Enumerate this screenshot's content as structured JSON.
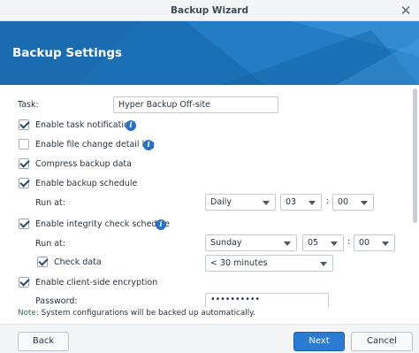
{
  "window": {
    "title": "Backup Wizard"
  },
  "header": {
    "title": "Backup Settings"
  },
  "form": {
    "task_label": "Task:",
    "task_value": "Hyper Backup Off-site",
    "enable_task_notification": {
      "label": "Enable task notification",
      "checked": true
    },
    "enable_file_change_log": {
      "label": "Enable file change detail log",
      "checked": false
    },
    "compress_backup_data": {
      "label": "Compress backup data",
      "checked": true
    },
    "enable_backup_schedule": {
      "label": "Enable backup schedule",
      "checked": true
    },
    "backup_run_at": {
      "label": "Run at:",
      "frequency": "Daily",
      "hour": "03",
      "minute": "00"
    },
    "enable_integrity_check_schedule": {
      "label": "Enable integrity check schedule",
      "checked": true
    },
    "integrity_run_at": {
      "label": "Run at:",
      "day": "Sunday",
      "hour": "05",
      "minute": "00"
    },
    "check_data": {
      "label": "Check data",
      "checked": true,
      "duration": "< 30 minutes"
    },
    "enable_client_side_encryption": {
      "label": "Enable client-side encryption",
      "checked": true
    },
    "password": {
      "label": "Password:",
      "value": "••••••••••"
    },
    "time_separator": ":"
  },
  "note": {
    "key": "Note:",
    "text": " System configurations will be backed up automatically."
  },
  "footer": {
    "back_label": "Back",
    "next_label": "Next",
    "cancel_label": "Cancel"
  },
  "colors": {
    "banner": "#1b6fb5",
    "primary_button": "#2b7bd3",
    "note_key": "#1f7a3d"
  },
  "icons": {
    "info": "info-icon",
    "close": "close-icon",
    "dropdown": "chevron-down-icon"
  }
}
